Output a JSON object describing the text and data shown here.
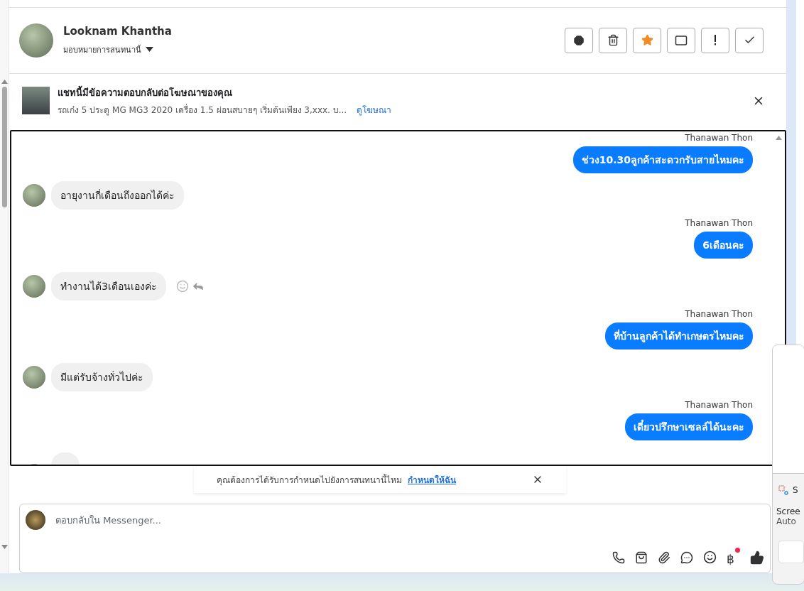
{
  "header": {
    "name": "Looknam Khantha",
    "assign_label": "มอบหมายการสนทนานี้"
  },
  "ad_banner": {
    "title": "แชทนี้มีข้อความตอบกลับต่อโฆษณาของคุณ",
    "description": "รถเก๋ง 5 ประตู MG MG3 2020 เครื่อง 1.5 ผ่อนสบายๆ เริ่มต้นเพียง 3,xxx. บ...",
    "link": "ดูโฆษณา"
  },
  "messages": [
    {
      "kind": "outgoing",
      "sender": "Thanawan Thon",
      "text": "ช่วง10.30ลูกค้าสะดวกรับสายไหมคะ"
    },
    {
      "kind": "incoming",
      "text": "อายุงานกี่เดือนถึงออกได้ค่ะ",
      "actions_visible": false
    },
    {
      "kind": "outgoing",
      "sender": "Thanawan Thon",
      "text": "6เดือนคะ"
    },
    {
      "kind": "incoming",
      "text": "ทำงานได้3เดือนเองค่ะ",
      "actions_visible": true
    },
    {
      "kind": "outgoing",
      "sender": "Thanawan Thon",
      "text": "ที่บ้านลูกค้าได้ทำเกษตรไหมคะ"
    },
    {
      "kind": "incoming",
      "text": "มีแต่รับจ้างทั่วไปค่ะ",
      "actions_visible": false
    },
    {
      "kind": "outgoing",
      "sender": "Thanawan Thon",
      "text": "เดี๋ยวปรึกษาเซลล์ได้นะคะ"
    },
    {
      "kind": "incoming_cut"
    }
  ],
  "assign_notice": {
    "text": "คุณต้องการได้รับการกำหนดไปยังการสนทนานี้ไหม",
    "link": "กำหนดให้ฉัน"
  },
  "composer": {
    "placeholder": "ตอบกลับใน Messenger...",
    "currency_symbol": "฿",
    "currency_badge": true
  },
  "side_popup": {
    "app_name": "S",
    "title": "Scree",
    "subtitle": "Auto"
  }
}
